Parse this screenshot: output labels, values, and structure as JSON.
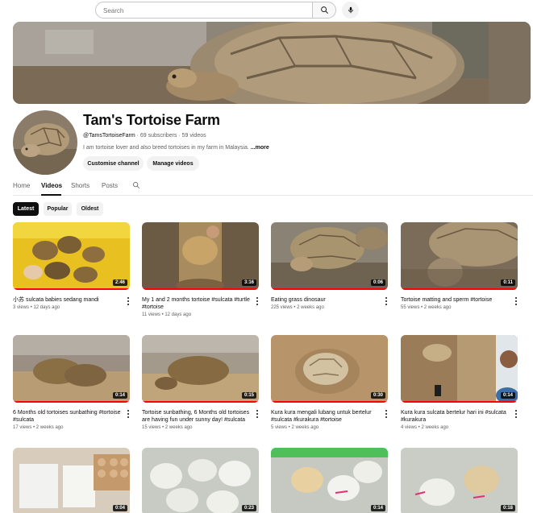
{
  "search": {
    "placeholder": "Search"
  },
  "channel": {
    "name": "Tam's Tortoise Farm",
    "handle": "@TamsTortoiseFarm",
    "stats": " · 69 subscribers · 59 videos",
    "description": "I am tortoise lover and also breed tortoises in my farm in Malaysia.",
    "more_label": "...more",
    "customise_label": "Customise channel",
    "manage_label": "Manage videos"
  },
  "tabs": [
    "Home",
    "Videos",
    "Shorts",
    "Posts"
  ],
  "chips": [
    "Latest",
    "Popular",
    "Oldest"
  ],
  "videos": [
    {
      "title": "小苏 sulcata babies sedang mandi",
      "meta": "3 views • 12 days ago",
      "duration": "2:46"
    },
    {
      "title": "My 1 and 2 months tortoise #sulcata #turtle #tortoise",
      "meta": "11 views • 12 days ago",
      "duration": "3:16"
    },
    {
      "title": "Eating grass dinosaur",
      "meta": "225 views • 2 weeks ago",
      "duration": "0:06"
    },
    {
      "title": "Tortoise matting and sperm #tortoise",
      "meta": "55 views • 2 weeks ago",
      "duration": "0:11"
    },
    {
      "title": "6 Months old tortoises sunbathing #tortoise #sulcata",
      "meta": "17 views • 2 weeks ago",
      "duration": "0:14"
    },
    {
      "title": "Tortoise sunbathing, 6 Months old tortoises are having fun under sunny day! #sulcata",
      "meta": "15 views • 2 weeks ago",
      "duration": "0:15"
    },
    {
      "title": "Kura kura mengali lubang untuk bertelur #sulcata #kurakura #tortoise",
      "meta": "5 views • 2 weeks ago",
      "duration": "0:30"
    },
    {
      "title": "Kura kura sulcata bertelur hari ini #sulcata #kurakura",
      "meta": "4 views • 2 weeks ago",
      "duration": "0:14"
    },
    {
      "title": "",
      "meta": "",
      "duration": "0:04"
    },
    {
      "title": "",
      "meta": "",
      "duration": "0:23"
    },
    {
      "title": "",
      "meta": "",
      "duration": "0:14"
    },
    {
      "title": "",
      "meta": "",
      "duration": "0:18"
    }
  ],
  "colors": {
    "accent": "#ff0000",
    "text": "#0f0f0f",
    "secondary": "#606060",
    "chip_bg": "#f2f2f2"
  },
  "icons": {
    "search": "search-icon",
    "mic": "mic-icon",
    "tab_search": "search-icon"
  }
}
